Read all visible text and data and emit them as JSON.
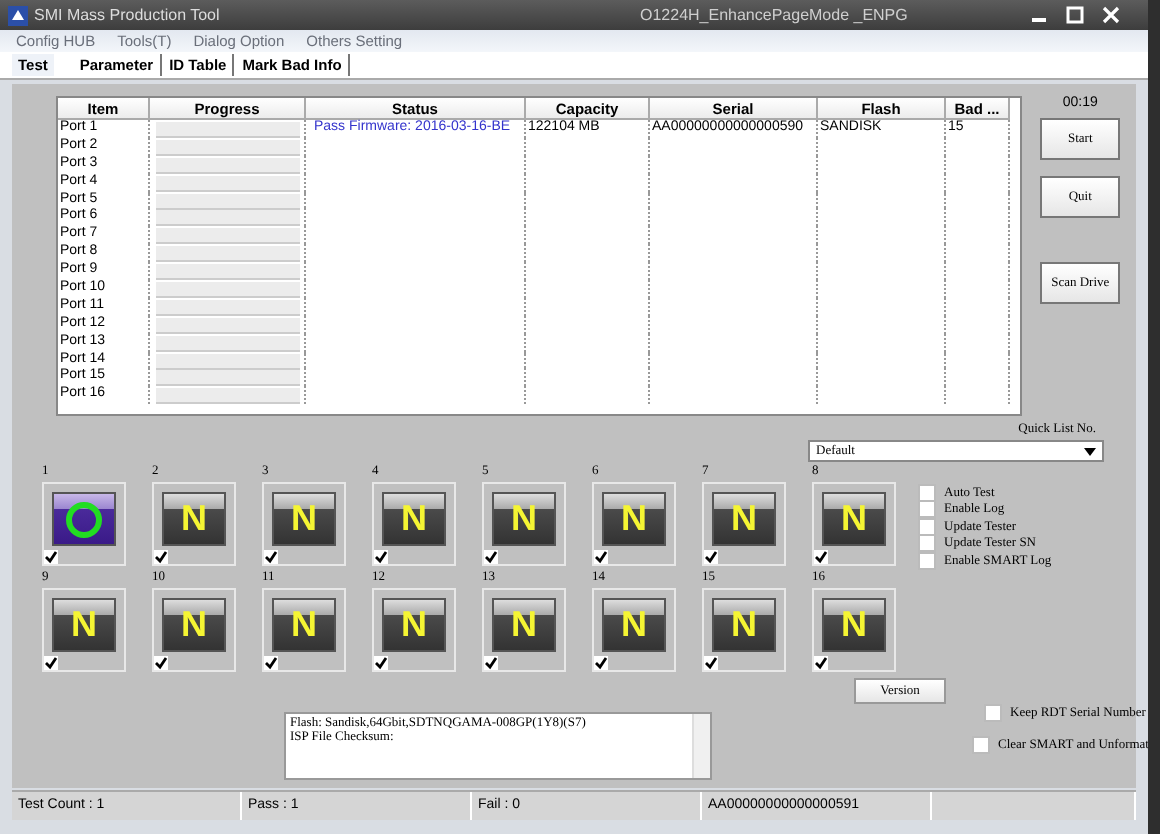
{
  "window": {
    "title": "SMI Mass Production Tool",
    "subtitle": "O1224H_EnhancePageMode       _ENPG"
  },
  "menu": [
    "Config HUB",
    "Tools(T)",
    "Dialog Option",
    "Others Setting"
  ],
  "tabs": [
    {
      "label": "Test",
      "selected": true
    },
    {
      "label": "Parameter",
      "selected": false
    },
    {
      "label": "ID Table",
      "selected": false
    },
    {
      "label": "Mark Bad Info",
      "selected": false
    }
  ],
  "table": {
    "columns": [
      "Item",
      "Progress",
      "Status",
      "Capacity",
      "Serial",
      "Flash",
      "Bad ..."
    ],
    "rows": [
      {
        "item": "Port 1",
        "level": 0,
        "status": "Pass   Firmware: 2016-03-16-BE",
        "capacity": "122104 MB",
        "serial": "AA00000000000000590",
        "flash": "SANDISK",
        "bad": "15"
      },
      {
        "item": "Port 2",
        "level": 0
      },
      {
        "item": "Port 3",
        "level": 0
      },
      {
        "item": "Port 4",
        "level": 0
      },
      {
        "item": "Port 5",
        "level": 0
      },
      {
        "item": "Port 6",
        "level": 0
      },
      {
        "item": "Port 7",
        "level": 0
      },
      {
        "item": "Port 8",
        "level": 0
      },
      {
        "item": "Port 9",
        "level": 0
      },
      {
        "item": "Port 10",
        "level": 0
      },
      {
        "item": "Port 11",
        "level": 0
      },
      {
        "item": "Port 12",
        "level": 0
      },
      {
        "item": "Port 13",
        "level": 0
      },
      {
        "item": "Port 14",
        "level": 0
      },
      {
        "item": "Port 15",
        "level": 0
      },
      {
        "item": "Port 16",
        "level": 0
      }
    ]
  },
  "timer": "00:19",
  "side_buttons": [
    "Start",
    "Quit",
    "Scan Drive"
  ],
  "quick_list": {
    "label": "Quick List No.",
    "value": "Default"
  },
  "ports": [
    {
      "number": "1",
      "kind": "pass",
      "checked": true
    },
    {
      "number": "2",
      "kind": "none",
      "label": "N",
      "checked": true
    },
    {
      "number": "3",
      "kind": "none",
      "label": "N",
      "checked": true
    },
    {
      "number": "4",
      "kind": "none",
      "label": "N",
      "checked": true
    },
    {
      "number": "5",
      "kind": "none",
      "label": "N",
      "checked": true
    },
    {
      "number": "6",
      "kind": "none",
      "label": "N",
      "checked": true
    },
    {
      "number": "7",
      "kind": "none",
      "label": "N",
      "checked": true
    },
    {
      "number": "8",
      "kind": "none",
      "label": "N",
      "checked": true
    },
    {
      "number": "9",
      "kind": "none",
      "label": "N",
      "checked": true
    },
    {
      "number": "10",
      "kind": "none",
      "label": "N",
      "checked": true
    },
    {
      "number": "11",
      "kind": "none",
      "label": "N",
      "checked": true
    },
    {
      "number": "12",
      "kind": "none",
      "label": "N",
      "checked": true
    },
    {
      "number": "13",
      "kind": "none",
      "label": "N",
      "checked": true
    },
    {
      "number": "14",
      "kind": "none",
      "label": "N",
      "checked": true
    },
    {
      "number": "15",
      "kind": "none",
      "label": "N",
      "checked": true
    },
    {
      "number": "16",
      "kind": "none",
      "label": "N",
      "checked": true
    }
  ],
  "options": [
    {
      "label": "Auto Test",
      "checked": false
    },
    {
      "label": "Enable Log",
      "checked": false
    },
    {
      "label": "Update Tester",
      "checked": false
    },
    {
      "label": "Update Tester SN",
      "checked": false
    },
    {
      "label": "Enable SMART Log",
      "checked": false
    }
  ],
  "version_button": "Version",
  "keep_rdt": {
    "label": "Keep RDT Serial Number",
    "checked": false
  },
  "clear_smart": {
    "label": "Clear SMART and Unformat",
    "checked": false
  },
  "log": [
    "Flash: Sandisk,64Gbit,SDTNQGAMA-008GP(1Y8)(S7)",
    "ISP File Checksum:"
  ],
  "status_bar": [
    "Test Count : 1",
    "Pass : 1",
    "Fail : 0",
    "AA00000000000000591"
  ]
}
